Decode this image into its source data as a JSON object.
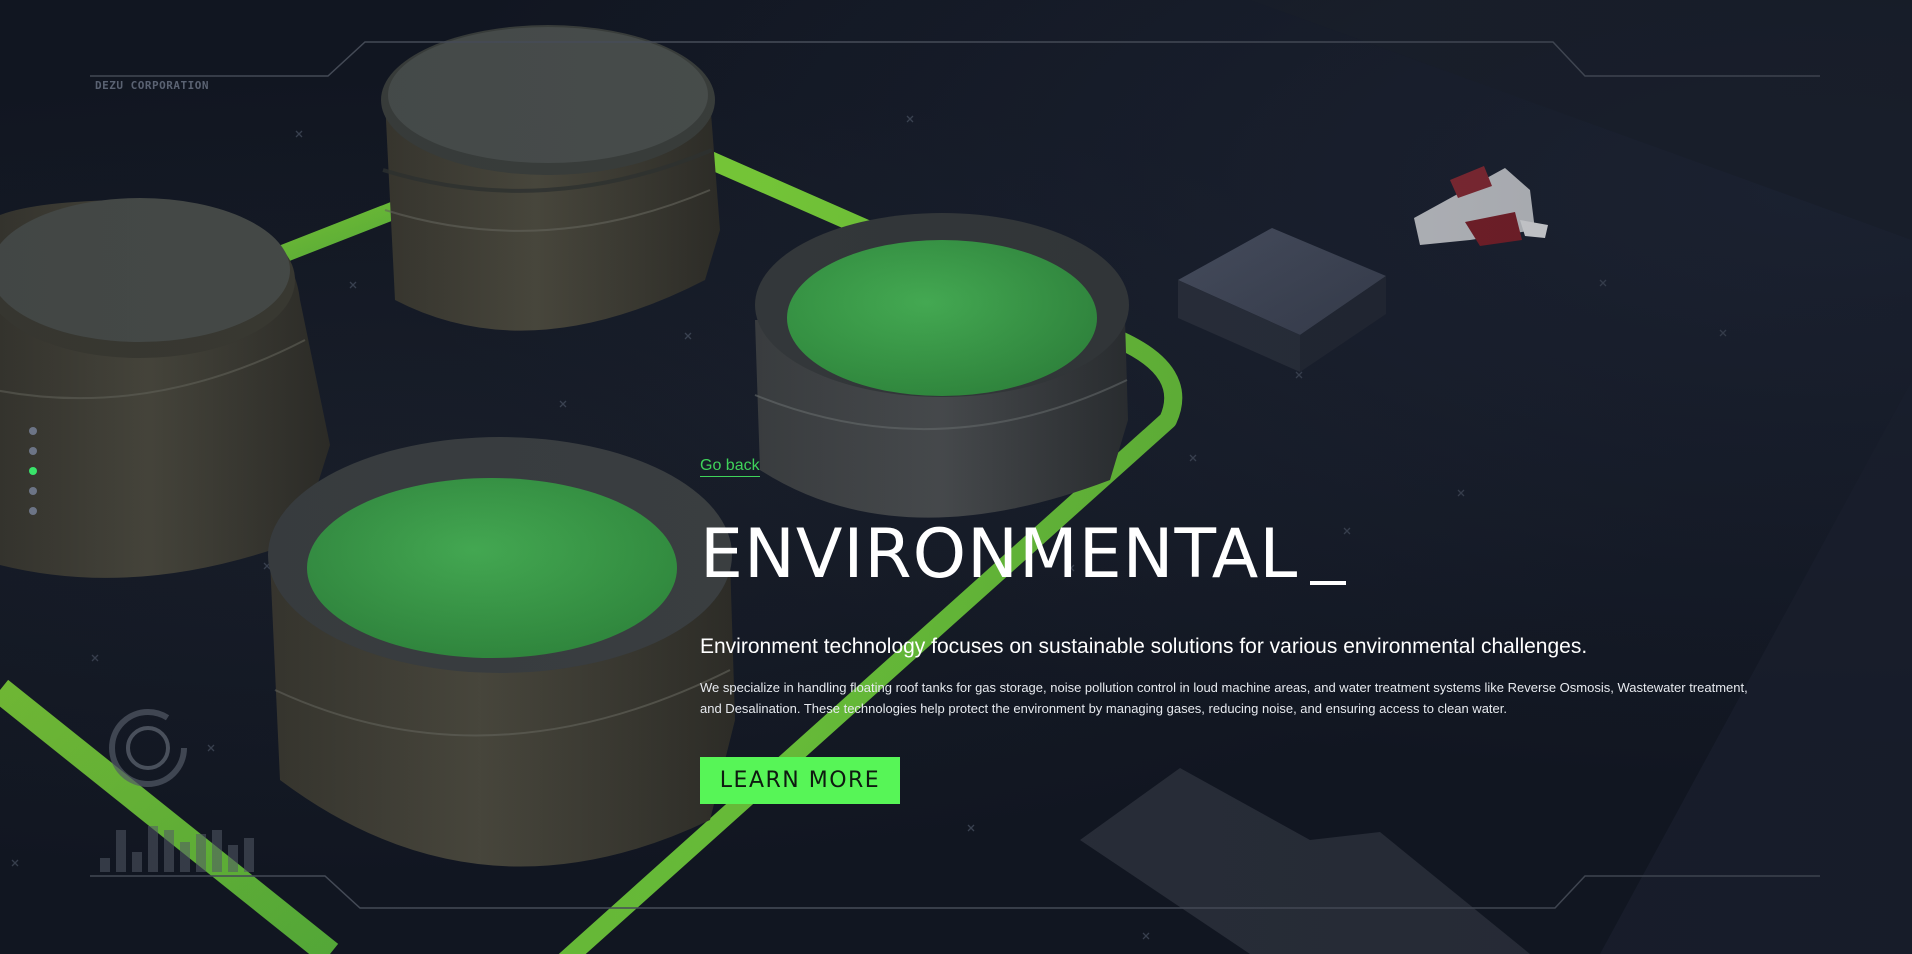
{
  "brand": {
    "name": "DEZU CORPORATION"
  },
  "section_nav": {
    "dots": [
      {
        "active": false
      },
      {
        "active": false
      },
      {
        "active": true
      },
      {
        "active": false
      },
      {
        "active": false
      }
    ]
  },
  "hero": {
    "back_label": "Go back",
    "title": "ENVIRONMENTAL",
    "subtitle": "Environment technology focuses on sustainable solutions for various environmental challenges.",
    "description": "We specialize in handling floating roof tanks for gas storage, noise pollution control in loud machine areas, and water treatment systems like Reverse Osmosis, Wastewater treatment, and Desalination. These technologies help protect the environment by managing gases, reducing noise, and ensuring access to clean water.",
    "cta_label": "LEARN MORE"
  },
  "colors": {
    "background": "#111621",
    "accent_green": "#57f557",
    "link_green": "#3fd35a",
    "pipe_green": "#6ad63a",
    "tank_body": "#474539",
    "tank_water": "#3d9e48"
  },
  "icons": {
    "hud_ring": "ring-icon",
    "hud_bars": "bar-graph-icon"
  }
}
